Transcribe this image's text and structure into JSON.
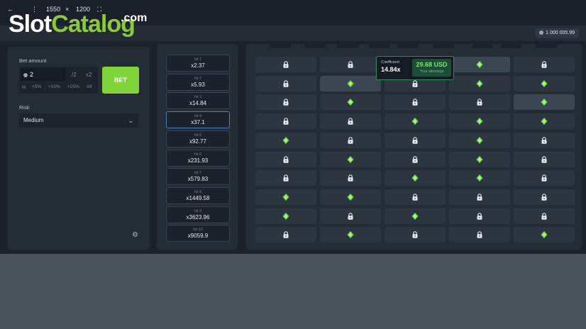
{
  "topbar": {
    "back": "←",
    "menu": "⋮",
    "width": "1550",
    "times": "×",
    "height": "1200",
    "fullscreen": "⛶"
  },
  "logo": {
    "slot": "Slot",
    "catalog": "Catalog",
    "com": ".com"
  },
  "balance": "1 000 005.99",
  "bet": {
    "label": "Bet amount",
    "value": "2",
    "half": "/2",
    "double": "x2",
    "quick": [
      "+5%",
      "+10%",
      "+25%",
      "All"
    ],
    "button": "BET"
  },
  "risk": {
    "label": "Risk",
    "value": "Medium"
  },
  "hits": [
    {
      "label": "hit 1",
      "mult": "x2.37"
    },
    {
      "label": "hit 2",
      "mult": "x5.93"
    },
    {
      "label": "hit 3",
      "mult": "x14.84"
    },
    {
      "label": "hit 4",
      "mult": "x37.1"
    },
    {
      "label": "hit 5",
      "mult": "x92.77"
    },
    {
      "label": "hit 6",
      "mult": "x231.93"
    },
    {
      "label": "hit 7",
      "mult": "x579.83"
    },
    {
      "label": "hit 8",
      "mult": "x1449.58"
    },
    {
      "label": "hit 9",
      "mult": "x3623.96"
    },
    {
      "label": "hit 10",
      "mult": "x9059.9"
    }
  ],
  "active_hit": 4,
  "board": [
    [
      "lock",
      "lock",
      "lock",
      "gem",
      "lock"
    ],
    [
      "lock",
      "gem",
      "lock",
      "gem",
      "gem"
    ],
    [
      "lock",
      "gem",
      "lock",
      "lock",
      "gem"
    ],
    [
      "lock",
      "lock",
      "gem",
      "gem",
      "gem"
    ],
    [
      "gem",
      "lock",
      "lock",
      "gem",
      "lock"
    ],
    [
      "lock",
      "gem",
      "lock",
      "gem",
      "lock"
    ],
    [
      "lock",
      "lock",
      "gem",
      "gem",
      "lock"
    ],
    [
      "gem",
      "gem",
      "lock",
      "lock",
      "lock"
    ],
    [
      "gem",
      "lock",
      "gem",
      "lock",
      "lock"
    ],
    [
      "lock",
      "gem",
      "lock",
      "lock",
      "gem"
    ]
  ],
  "highlighted": [
    [
      0,
      3
    ],
    [
      1,
      1
    ],
    [
      2,
      4
    ]
  ],
  "coefficient": {
    "label": "Coefficient",
    "value": "14.84x",
    "win_value": "29.68 USD",
    "win_label": "Your winnings"
  },
  "colors": {
    "accent": "#7fd43a",
    "gem": "#6fe04a",
    "lock": "#e6ebf0"
  }
}
